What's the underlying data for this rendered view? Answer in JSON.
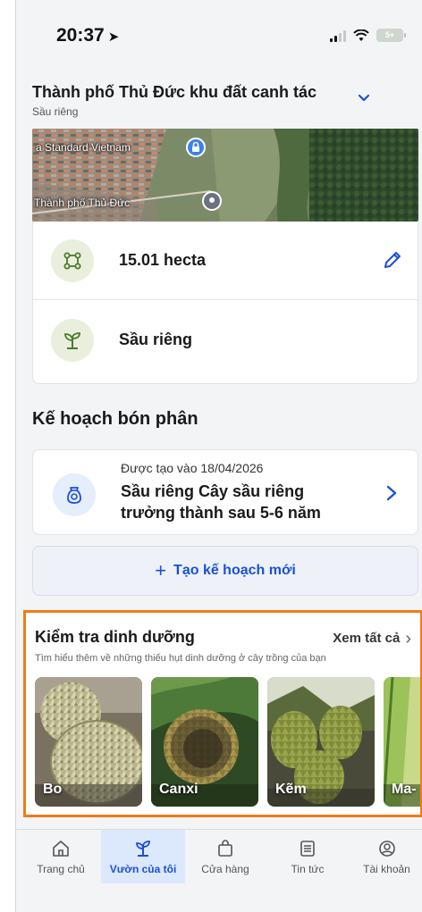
{
  "status_bar": {
    "time": "20:37",
    "battery": "5+"
  },
  "field": {
    "title": "Thành phố Thủ Đức khu đất canh tác",
    "subtitle": "Sầu riêng"
  },
  "map": {
    "label_1": "a Standard Vietnam",
    "label_2": "Thành phố Thủ Đức"
  },
  "info": {
    "area": "15.01 hecta",
    "crop": "Sầu riêng"
  },
  "plan": {
    "section_title": "Kế hoạch bón phân",
    "created": "Được tạo vào 18/04/2026",
    "title": "Sầu riêng Cây sầu riêng trưởng thành sau 5-6 năm",
    "new_plan_label": "Tạo kế hoạch mới"
  },
  "nutrition": {
    "title": "Kiểm tra dinh dưỡng",
    "see_all": "Xem tất cả",
    "description": "Tìm hiểu thêm về những thiếu hụt dinh dưỡng ở cây trồng của bạn",
    "items": [
      {
        "label": "Bo"
      },
      {
        "label": "Canxi"
      },
      {
        "label": "Kẽm"
      },
      {
        "label": "Ma-"
      }
    ]
  },
  "nav": {
    "items": [
      {
        "label": "Trang chủ"
      },
      {
        "label": "Vườn của tôi"
      },
      {
        "label": "Cửa hàng"
      },
      {
        "label": "Tin tức"
      },
      {
        "label": "Tài khoản"
      }
    ]
  },
  "colors": {
    "accent": "#1b4fd9",
    "highlight": "#f07b1a",
    "active_nav_bg": "#dce8fb",
    "icon_bg_green": "#e9efdc"
  }
}
